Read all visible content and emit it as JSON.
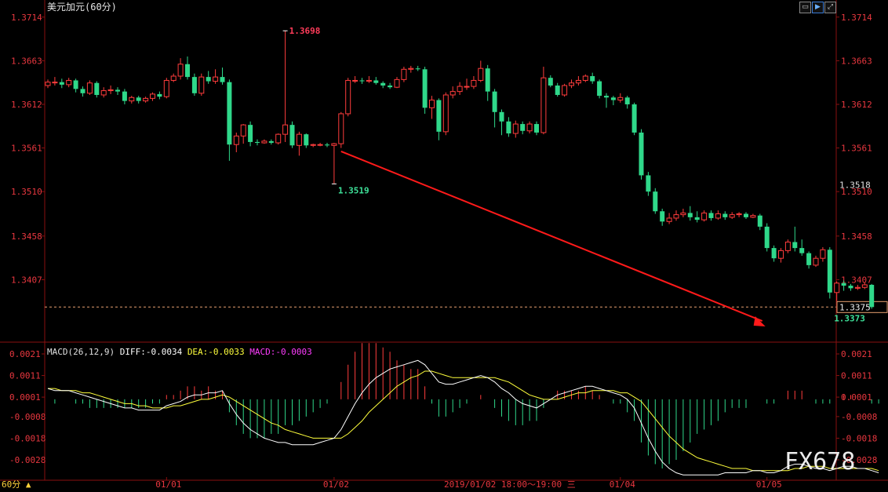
{
  "title": "美元加元(60分)",
  "period_label": "60分",
  "cursor_time": "2019/01/02 18:00～19:00 三",
  "watermark": "FX678",
  "colors": {
    "up": "#ff3c3c",
    "down": "#2fd88a",
    "price_label": "#e8373f",
    "axis": "#8a1010",
    "diff_line": "#ffffff",
    "dea_line": "#ffff3c",
    "macd_text": "#ff3cff",
    "trend_arrow": "#ff1a1a"
  },
  "toolbar": {
    "icons": [
      "box-icon",
      "play-icon",
      "expand-icon"
    ]
  },
  "macd_header": {
    "label": "MACD(26,12,9)",
    "diff": "DIFF:-0.0034",
    "dea": "DEA:-0.0033",
    "macd": "MACD:-0.0003"
  },
  "current_price": "1.3375",
  "mid_label": "1.3518",
  "annotations": {
    "high": "1.3698",
    "low_mid": "1.3519",
    "low_end": "1.3373"
  },
  "chart_data": {
    "type": "candlestick",
    "title": "美元加元(60分)",
    "price_ylim": [
      1.3334,
      1.3734
    ],
    "price_ticks": [
      "1.3714",
      "1.3663",
      "1.3612",
      "1.3561",
      "1.3510",
      "1.3458",
      "1.3407"
    ],
    "x_ticks": [
      {
        "label": "01/01",
        "index": 17
      },
      {
        "label": "01/02",
        "index": 41
      },
      {
        "label": "01/04",
        "index": 82
      },
      {
        "label": "01/05",
        "index": 103
      }
    ],
    "candles": [
      [
        1.3634,
        1.3638,
        1.3641,
        1.3631
      ],
      [
        1.3638,
        1.3638,
        1.3644,
        1.3634
      ],
      [
        1.3638,
        1.3635,
        1.3642,
        1.3631
      ],
      [
        1.3635,
        1.364,
        1.3643,
        1.3632
      ],
      [
        1.364,
        1.363,
        1.3642,
        1.3626
      ],
      [
        1.363,
        1.3625,
        1.3633,
        1.3621
      ],
      [
        1.3625,
        1.3637,
        1.364,
        1.3623
      ],
      [
        1.3637,
        1.3623,
        1.3639,
        1.362
      ],
      [
        1.3623,
        1.3628,
        1.3632,
        1.362
      ],
      [
        1.3628,
        1.3629,
        1.3634,
        1.3624
      ],
      [
        1.3629,
        1.3627,
        1.3632,
        1.3623
      ],
      [
        1.3627,
        1.3616,
        1.363,
        1.3612
      ],
      [
        1.3616,
        1.362,
        1.3622,
        1.3613
      ],
      [
        1.362,
        1.3616,
        1.3622,
        1.3613
      ],
      [
        1.3616,
        1.3619,
        1.3621,
        1.3614
      ],
      [
        1.3619,
        1.3624,
        1.3626,
        1.3616
      ],
      [
        1.3624,
        1.3621,
        1.3627,
        1.3618
      ],
      [
        1.3621,
        1.364,
        1.3643,
        1.3619
      ],
      [
        1.364,
        1.3645,
        1.3648,
        1.3638
      ],
      [
        1.3645,
        1.3659,
        1.3666,
        1.3641
      ],
      [
        1.3659,
        1.3644,
        1.3668,
        1.3641
      ],
      [
        1.3644,
        1.3625,
        1.3648,
        1.3622
      ],
      [
        1.3625,
        1.3644,
        1.3648,
        1.3622
      ],
      [
        1.3644,
        1.3639,
        1.3651,
        1.3636
      ],
      [
        1.3639,
        1.3644,
        1.3653,
        1.3636
      ],
      [
        1.3644,
        1.3638,
        1.3655,
        1.3635
      ],
      [
        1.3638,
        1.3565,
        1.3641,
        1.3546
      ],
      [
        1.3565,
        1.3575,
        1.3579,
        1.3556
      ],
      [
        1.3575,
        1.3588,
        1.3589,
        1.3566
      ],
      [
        1.3588,
        1.3568,
        1.3592,
        1.3563
      ],
      [
        1.3568,
        1.3567,
        1.3571,
        1.3564
      ],
      [
        1.3567,
        1.3569,
        1.3571,
        1.3566
      ],
      [
        1.3569,
        1.3567,
        1.3571,
        1.3565
      ],
      [
        1.3567,
        1.3577,
        1.3578,
        1.3565
      ],
      [
        1.3577,
        1.3588,
        1.3698,
        1.3568
      ],
      [
        1.3588,
        1.3564,
        1.3592,
        1.3561
      ],
      [
        1.3564,
        1.3577,
        1.358,
        1.3552
      ],
      [
        1.3577,
        1.3564,
        1.3578,
        1.3561
      ],
      [
        1.3564,
        1.3565,
        1.3566,
        1.3562
      ],
      [
        1.3565,
        1.3565,
        1.3567,
        1.3563
      ],
      [
        1.3565,
        1.3564,
        1.3567,
        1.3562
      ],
      [
        1.3564,
        1.3566,
        1.3567,
        1.3519
      ],
      [
        1.3566,
        1.3601,
        1.3603,
        1.3561
      ],
      [
        1.3601,
        1.364,
        1.3643,
        1.3598
      ],
      [
        1.364,
        1.364,
        1.3645,
        1.3637
      ],
      [
        1.364,
        1.3639,
        1.3643,
        1.3636
      ],
      [
        1.3639,
        1.364,
        1.3645,
        1.3637
      ],
      [
        1.364,
        1.3637,
        1.3644,
        1.3635
      ],
      [
        1.3637,
        1.3634,
        1.3639,
        1.3631
      ],
      [
        1.3634,
        1.3632,
        1.3637,
        1.363
      ],
      [
        1.3632,
        1.3641,
        1.3644,
        1.3631
      ],
      [
        1.3641,
        1.3653,
        1.3656,
        1.3638
      ],
      [
        1.3653,
        1.3654,
        1.3657,
        1.3649
      ],
      [
        1.3654,
        1.3653,
        1.3657,
        1.3651
      ],
      [
        1.3653,
        1.3608,
        1.3656,
        1.3601
      ],
      [
        1.3608,
        1.3617,
        1.3622,
        1.3595
      ],
      [
        1.3617,
        1.358,
        1.3619,
        1.357
      ],
      [
        1.358,
        1.3623,
        1.3626,
        1.3576
      ],
      [
        1.3623,
        1.3627,
        1.3633,
        1.3619
      ],
      [
        1.3627,
        1.3633,
        1.3638,
        1.3623
      ],
      [
        1.3633,
        1.3633,
        1.3642,
        1.3629
      ],
      [
        1.3633,
        1.364,
        1.3645,
        1.363
      ],
      [
        1.364,
        1.3654,
        1.3663,
        1.3638
      ],
      [
        1.3654,
        1.3627,
        1.3658,
        1.3616
      ],
      [
        1.3627,
        1.3603,
        1.363,
        1.3585
      ],
      [
        1.3603,
        1.3592,
        1.3606,
        1.3576
      ],
      [
        1.3592,
        1.3578,
        1.3597,
        1.3574
      ],
      [
        1.3578,
        1.3589,
        1.3593,
        1.3573
      ],
      [
        1.3589,
        1.3581,
        1.3592,
        1.3577
      ],
      [
        1.3581,
        1.3589,
        1.3592,
        1.3578
      ],
      [
        1.3589,
        1.3579,
        1.3592,
        1.3576
      ],
      [
        1.3579,
        1.3643,
        1.3656,
        1.3577
      ],
      [
        1.3643,
        1.3634,
        1.3646,
        1.3632
      ],
      [
        1.3634,
        1.3623,
        1.3637,
        1.3621
      ],
      [
        1.3623,
        1.3634,
        1.3636,
        1.3621
      ],
      [
        1.3634,
        1.3637,
        1.3641,
        1.3631
      ],
      [
        1.3637,
        1.364,
        1.3645,
        1.3634
      ],
      [
        1.364,
        1.3645,
        1.3647,
        1.3638
      ],
      [
        1.3645,
        1.3639,
        1.3649,
        1.3636
      ],
      [
        1.3639,
        1.3622,
        1.3641,
        1.3619
      ],
      [
        1.3622,
        1.362,
        1.3625,
        1.3608
      ],
      [
        1.362,
        1.3617,
        1.3622,
        1.3611
      ],
      [
        1.3617,
        1.362,
        1.3625,
        1.3614
      ],
      [
        1.362,
        1.3612,
        1.3622,
        1.3607
      ],
      [
        1.3612,
        1.3579,
        1.3614,
        1.3576
      ],
      [
        1.3579,
        1.3529,
        1.3583,
        1.3524
      ],
      [
        1.3529,
        1.351,
        1.3533,
        1.3505
      ],
      [
        1.351,
        1.3487,
        1.3514,
        1.3484
      ],
      [
        1.3487,
        1.3475,
        1.349,
        1.347
      ],
      [
        1.3475,
        1.3479,
        1.3485,
        1.3472
      ],
      [
        1.3479,
        1.3483,
        1.3488,
        1.3476
      ],
      [
        1.3483,
        1.3485,
        1.349,
        1.348
      ],
      [
        1.3485,
        1.348,
        1.3493,
        1.3476
      ],
      [
        1.348,
        1.3477,
        1.3487,
        1.3474
      ],
      [
        1.3477,
        1.3485,
        1.3488,
        1.3475
      ],
      [
        1.3485,
        1.3479,
        1.3488,
        1.3476
      ],
      [
        1.3479,
        1.3484,
        1.3488,
        1.3477
      ],
      [
        1.3484,
        1.348,
        1.3487,
        1.3477
      ],
      [
        1.348,
        1.3483,
        1.3486,
        1.3478
      ],
      [
        1.3483,
        1.3484,
        1.3486,
        1.348
      ],
      [
        1.3484,
        1.348,
        1.3486,
        1.3478
      ],
      [
        1.348,
        1.3482,
        1.3484,
        1.3479
      ],
      [
        1.3482,
        1.3469,
        1.3484,
        1.3465
      ],
      [
        1.3469,
        1.3444,
        1.3473,
        1.344
      ],
      [
        1.3444,
        1.3432,
        1.3447,
        1.3428
      ],
      [
        1.3432,
        1.3441,
        1.3444,
        1.3427
      ],
      [
        1.3441,
        1.3451,
        1.3454,
        1.3438
      ],
      [
        1.3451,
        1.3444,
        1.3469,
        1.344
      ],
      [
        1.3444,
        1.3438,
        1.3454,
        1.3435
      ],
      [
        1.3438,
        1.3424,
        1.344,
        1.342
      ],
      [
        1.3424,
        1.3432,
        1.3435,
        1.3422
      ],
      [
        1.3432,
        1.3442,
        1.3445,
        1.3428
      ],
      [
        1.3442,
        1.3392,
        1.3445,
        1.3385
      ],
      [
        1.3392,
        1.3403,
        1.3405,
        1.3382
      ],
      [
        1.3403,
        1.34,
        1.3406,
        1.3394
      ],
      [
        1.34,
        1.3397,
        1.3402,
        1.3394
      ],
      [
        1.3397,
        1.3398,
        1.3401,
        1.3395
      ],
      [
        1.3398,
        1.3401,
        1.3404,
        1.3396
      ],
      [
        1.3401,
        1.3375,
        1.3402,
        1.3373
      ]
    ],
    "macd": {
      "ylim": [
        -0.0036,
        0.0025
      ],
      "ticks": [
        "0.0021",
        "0.0011",
        "0.0001",
        "-0.0008",
        "-0.0018",
        "-0.0028"
      ],
      "diff": [
        0.0005,
        0.0004,
        0.0004,
        0.0004,
        0.0003,
        0.0002,
        0.0001,
        0.0,
        -0.0001,
        -0.0002,
        -0.0003,
        -0.0004,
        -0.0004,
        -0.0005,
        -0.0005,
        -0.0005,
        -0.0005,
        -0.0003,
        -0.0002,
        -0.0001,
        0.0001,
        0.0002,
        0.0002,
        0.0003,
        0.0003,
        0.0004,
        -0.0002,
        -0.0007,
        -0.0011,
        -0.0014,
        -0.0016,
        -0.0018,
        -0.0019,
        -0.002,
        -0.002,
        -0.0021,
        -0.0021,
        -0.0021,
        -0.0021,
        -0.002,
        -0.0019,
        -0.0018,
        -0.0014,
        -0.0008,
        -0.0002,
        0.0003,
        0.0007,
        0.001,
        0.0012,
        0.0014,
        0.0015,
        0.0016,
        0.0017,
        0.0018,
        0.0016,
        0.0012,
        0.0008,
        0.0007,
        0.0007,
        0.0008,
        0.0009,
        0.001,
        0.0011,
        0.001,
        0.0008,
        0.0005,
        0.0003,
        0.0,
        -0.0002,
        -0.0003,
        -0.0004,
        -0.0002,
        0.0,
        0.0002,
        0.0003,
        0.0004,
        0.0005,
        0.0006,
        0.0006,
        0.0005,
        0.0004,
        0.0003,
        0.0002,
        0.0,
        -0.0004,
        -0.0011,
        -0.0018,
        -0.0024,
        -0.0029,
        -0.0032,
        -0.0034,
        -0.0035,
        -0.0035,
        -0.0035,
        -0.0035,
        -0.0035,
        -0.0035,
        -0.0034,
        -0.0034,
        -0.0034,
        -0.0034,
        -0.0033,
        -0.0033,
        -0.0034,
        -0.0034,
        -0.0033,
        -0.0031,
        -0.003,
        -0.003,
        -0.0031,
        -0.0032,
        -0.0032,
        -0.0033,
        -0.0032,
        -0.0031,
        -0.0031,
        -0.0032,
        -0.0032,
        -0.0033,
        -0.0034
      ],
      "dea": [
        0.0005,
        0.0005,
        0.0004,
        0.0004,
        0.0004,
        0.0003,
        0.0003,
        0.0002,
        0.0001,
        0.0,
        -0.0001,
        -0.0002,
        -0.0002,
        -0.0003,
        -0.0003,
        -0.0004,
        -0.0004,
        -0.0004,
        -0.0003,
        -0.0003,
        -0.0002,
        -0.0001,
        0.0,
        0.0,
        0.0001,
        0.0002,
        0.0001,
        -0.0001,
        -0.0003,
        -0.0005,
        -0.0007,
        -0.0009,
        -0.0011,
        -0.0012,
        -0.0014,
        -0.0015,
        -0.0016,
        -0.0017,
        -0.0018,
        -0.0018,
        -0.0018,
        -0.0018,
        -0.0018,
        -0.0016,
        -0.0013,
        -0.001,
        -0.0006,
        -0.0003,
        0.0,
        0.0003,
        0.0006,
        0.0008,
        0.001,
        0.0011,
        0.0013,
        0.0013,
        0.0012,
        0.0011,
        0.001,
        0.001,
        0.001,
        0.001,
        0.001,
        0.001,
        0.001,
        0.0009,
        0.0008,
        0.0006,
        0.0004,
        0.0002,
        0.0001,
        0.0,
        0.0,
        0.0,
        0.0001,
        0.0002,
        0.0003,
        0.0003,
        0.0004,
        0.0004,
        0.0004,
        0.0004,
        0.0003,
        0.0003,
        0.0001,
        -0.0001,
        -0.0005,
        -0.0009,
        -0.0013,
        -0.0017,
        -0.002,
        -0.0023,
        -0.0025,
        -0.0027,
        -0.0028,
        -0.0029,
        -0.003,
        -0.0031,
        -0.0032,
        -0.0032,
        -0.0032,
        -0.0033,
        -0.0033,
        -0.0033,
        -0.0033,
        -0.0033,
        -0.0033,
        -0.0032,
        -0.0032,
        -0.0031,
        -0.0031,
        -0.0031,
        -0.0032,
        -0.0032,
        -0.0032,
        -0.0032,
        -0.0032,
        -0.0032,
        -0.0032,
        -0.0033
      ]
    },
    "trend_arrow": {
      "from_index": 42,
      "from_price": 1.3557,
      "to_index": 103,
      "to_price": 1.3356
    }
  }
}
